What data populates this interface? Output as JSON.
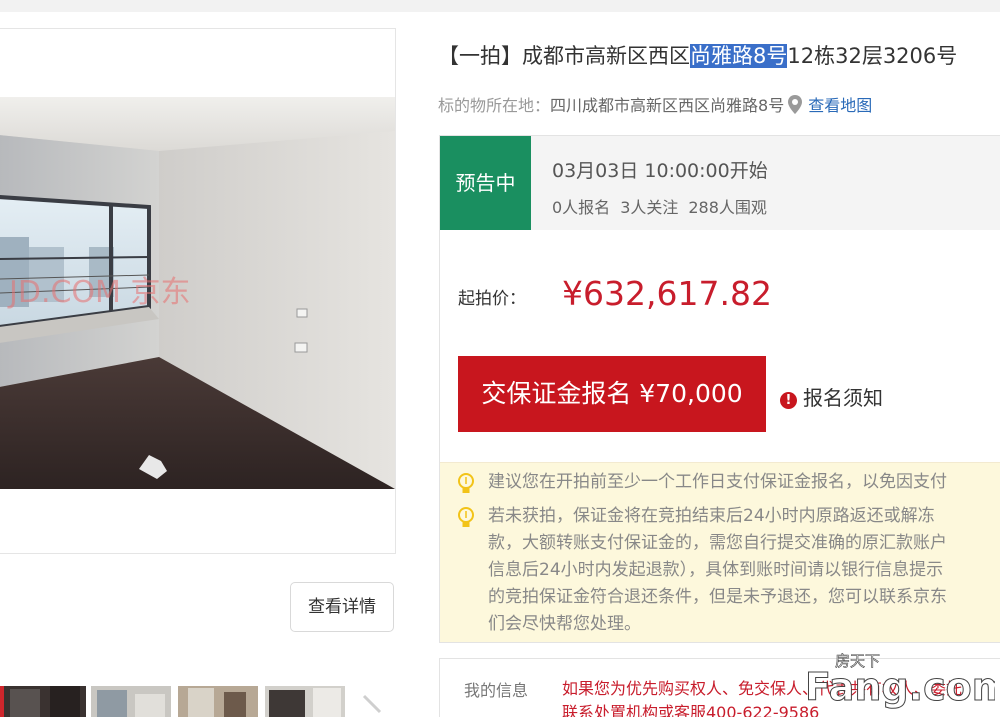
{
  "listing": {
    "title_prefix": "【一拍】成都市高新区西区",
    "title_highlight": "尚雅路8号",
    "title_suffix": "12栋32层3206号",
    "location_label": "标的物所在地：",
    "location_value": "四川成都市高新区西区尚雅路8号",
    "map_link": "查看地图"
  },
  "gallery": {
    "photo_watermark": "JD.COM 京东",
    "detail_button": "查看详情",
    "thumb_count": 4
  },
  "auction": {
    "status": "预告中",
    "start_time": "03月03日 10:00:00开始",
    "registered": "0人报名",
    "followers": "3人关注",
    "viewers": "288人围观",
    "price_label": "起拍价：",
    "price_value": "¥632,617.82",
    "deposit_button": "交保证金报名 ¥70,000",
    "notice_link": "报名须知"
  },
  "tips": [
    "建议您在开拍前至少一个工作日支付保证金报名，以免因支付",
    "若未获拍，保证金将在竞拍结束后24小时内原路返还或解冻\n款，大额转账支付保证金的，需您自行提交准确的原汇款账户\n信息后24小时内发起退款），具体到账时间请以银行信息提示\n的竞拍保证金符合退还条件，但是未予退还，您可以联系京东\n们会尽快帮您处理。"
  ],
  "my_info": {
    "label": "我的信息",
    "text": "如果您为优先购买权人、免交保人、代表共有权人、委托\n联系处置机构或客服400-622-9586"
  },
  "site_watermark": {
    "cn": "房天下",
    "en": "Fang.com"
  },
  "colors": {
    "accent_red": "#c8161e",
    "status_green": "#1a8f60",
    "link_blue": "#2a6ab8",
    "highlight_blue": "#3a6fc9",
    "tip_bg": "#fdf8dc"
  }
}
